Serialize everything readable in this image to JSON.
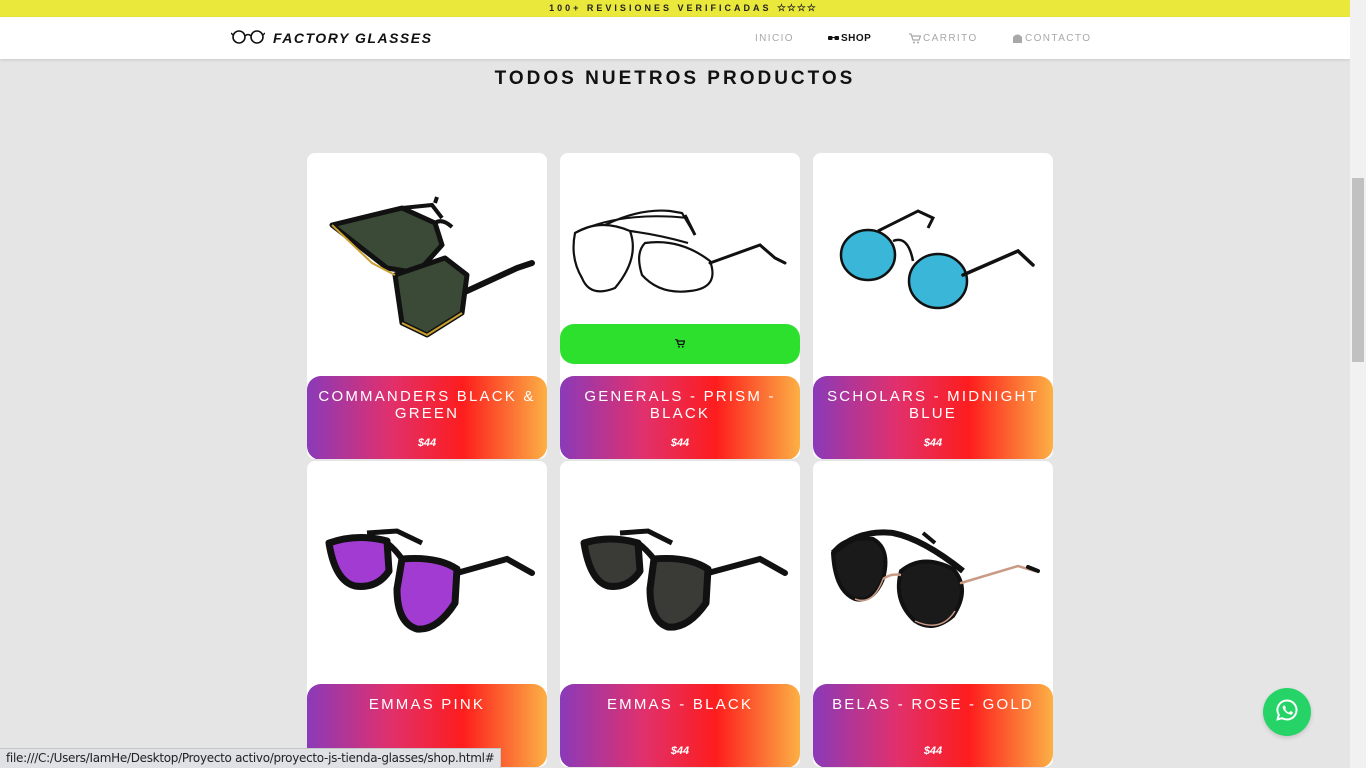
{
  "topbar": {
    "text": "100+ REVISIONES VERIFICADAS",
    "stars": "☆☆☆☆"
  },
  "header": {
    "brand": "FACTORY GLASSES",
    "nav": [
      {
        "label": "INICIO",
        "icon": ""
      },
      {
        "label": "SHOP",
        "icon": "glasses-icon"
      },
      {
        "label": "CARRITO",
        "icon": "cart-icon"
      },
      {
        "label": "CONTACTO",
        "icon": "contact-icon"
      }
    ]
  },
  "main": {
    "title": "TODOS NUETROS PRODUCTOS"
  },
  "products": [
    {
      "name": "COMMANDERS BLACK & GREEN",
      "price": "$44",
      "lens_color": "#3b4a36",
      "frame_color": "#111111"
    },
    {
      "name": "GENERALS - PRISM - BLACK",
      "price": "$44",
      "lens_color": "#ffffff",
      "frame_color": "#111111"
    },
    {
      "name": "SCHOLARS - MIDNIGHT BLUE",
      "price": "$44",
      "lens_color": "#3ab6d9",
      "frame_color": "#111111"
    },
    {
      "name": "EMMAS PINK",
      "price": "",
      "lens_color": "#a23bd1",
      "frame_color": "#111111"
    },
    {
      "name": "EMMAS - BLACK",
      "price": "$44",
      "lens_color": "#3a3a36",
      "frame_color": "#111111"
    },
    {
      "name": "BELAS - ROSE - GOLD",
      "price": "$44",
      "lens_color": "#1a1a1a",
      "frame_color": "#111111"
    }
  ],
  "status": {
    "url": "file:///C:/Users/IamHe/Desktop/Proyecto activo/proyecto-js-tienda-glasses/shop.html#"
  },
  "colors": {
    "topbar": "#ebe83c",
    "cart_button": "#2de02d",
    "whatsapp": "#25d366",
    "page_bg": "#e5e5e5"
  }
}
